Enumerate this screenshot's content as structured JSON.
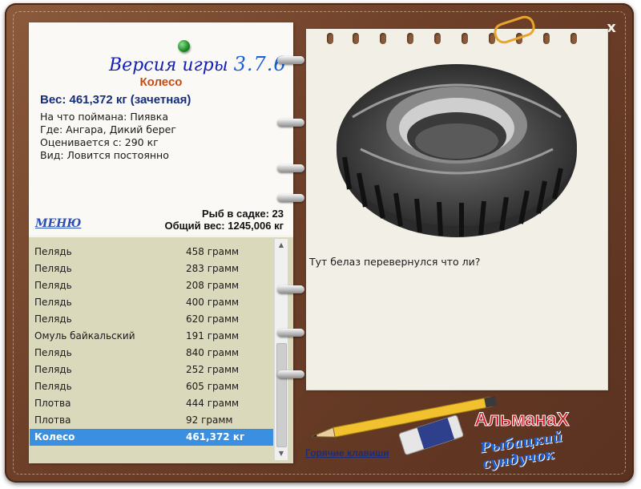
{
  "window": {
    "close_label": "x"
  },
  "header": {
    "version_prefix": "Версия игры",
    "version_number": "3.7.6"
  },
  "fish": {
    "name": "Колесо",
    "weight_line": "Вес: 461,372 кг (зачетная)",
    "bait": "На что поймана: Пиявка",
    "location": "Где: Ангара, Дикий берег",
    "value": "Оценивается с: 290 кг",
    "type": "Вид: Ловится постоянно"
  },
  "menu": {
    "label": "МЕНЮ"
  },
  "stats": {
    "keep_count": "Рыб в садке: 23",
    "total_weight": "Общий вес: 1245,006 кг"
  },
  "catch_list": [
    {
      "name": "Пелядь",
      "weight": "458 грамм"
    },
    {
      "name": "Пелядь",
      "weight": "283 грамм"
    },
    {
      "name": "Пелядь",
      "weight": "208 грамм"
    },
    {
      "name": "Пелядь",
      "weight": "400 грамм"
    },
    {
      "name": "Пелядь",
      "weight": "620 грамм"
    },
    {
      "name": "Омуль байкальский",
      "weight": "191 грамм"
    },
    {
      "name": "Пелядь",
      "weight": "840 грамм"
    },
    {
      "name": "Пелядь",
      "weight": "252 грамм"
    },
    {
      "name": "Пелядь",
      "weight": "605 грамм"
    },
    {
      "name": "Плотва",
      "weight": "444 грамм"
    },
    {
      "name": "Плотва",
      "weight": "92 грамм"
    },
    {
      "name": "Колесо",
      "weight": "461,372 кг",
      "selected": true
    }
  ],
  "detail": {
    "image_icon": "tire-image",
    "description": "Тут белаз перевернулся что ли?"
  },
  "footer": {
    "hotkeys_label": "Горячие клавиши",
    "logo_top": "АльманаХ",
    "logo_bottom": "Рыбацкий сундучок"
  },
  "colors": {
    "selection": "#3b8fe0",
    "fish_name": "#c84b15",
    "weight_text": "#142e7a",
    "version": "#1220b8"
  }
}
